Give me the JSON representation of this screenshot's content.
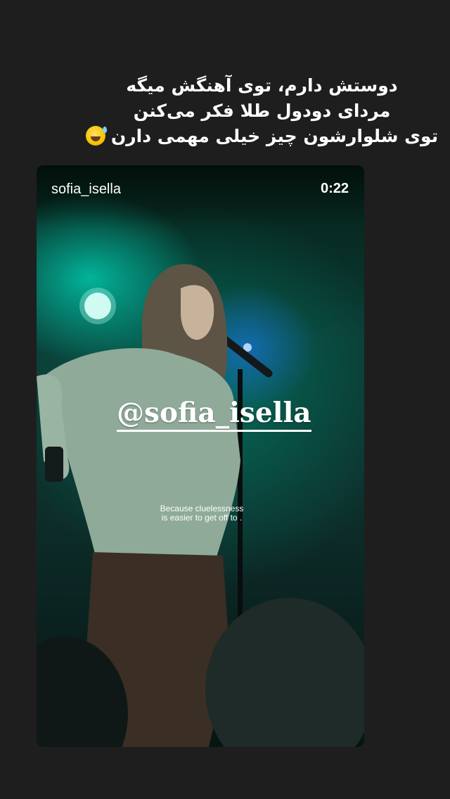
{
  "caption": {
    "lines": [
      "دوستش دارم، توی آهنگش میگه",
      "مردای دودول طلا فکر می‌کنن",
      "توی شلوارشون چیز خیلی مهمی دارن"
    ],
    "emoji": "grinning-sweat-emoji"
  },
  "video_card": {
    "username": "sofia_isella",
    "timer": "0:22",
    "mention_prefix": "@",
    "mention_name": "sofia_isella",
    "lyric_lines": [
      "Because cluelessness",
      "is easier to get off to ."
    ]
  },
  "colors": {
    "background": "#1e1e1e",
    "text": "#ffffff",
    "stage_green": "#00dcbe",
    "stage_blue": "#1e78ff"
  }
}
